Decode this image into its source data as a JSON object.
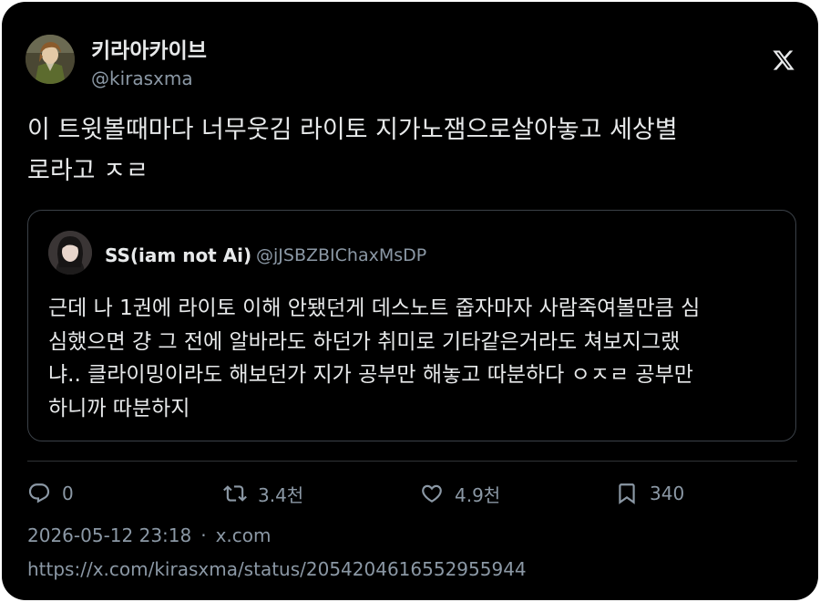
{
  "author": {
    "display_name": "키라아카이브",
    "handle": "@kirasxma"
  },
  "tweet": {
    "text_line1": "이 트윗볼때마다 너무웃김 라이토 지가노잼으로살아놓고 세상별",
    "text_line2": "로라고 ㅈㄹ"
  },
  "quote": {
    "display_name": "SS(iam not Ai)",
    "handle": "@jJSBZBIChaxMsDP",
    "text_line1": "근데 나 1권에 라이토 이해 안됐던게 데스노트 줍자마자 사람죽여볼만큼 심",
    "text_line2": "심했으면 걍 그 전에 알바라도 하던가 취미로 기타같은거라도 쳐보지그랬",
    "text_line3": "냐.. 클라이밍이라도 해보던가 지가 공부만 해놓고 따분하다 ㅇㅈㄹ 공부만",
    "text_line4": "하니까 따분하지"
  },
  "actions": {
    "replies": "0",
    "reposts": "3.4천",
    "likes": "4.9천",
    "bookmarks": "340"
  },
  "meta": {
    "timestamp": "2026-05-12 23:18",
    "separator": "·",
    "source": "x.com",
    "url": "https://x.com/kirasxma/status/2054204616552955944"
  },
  "icons": {
    "logo": "x-logo-icon",
    "reply": "reply-icon",
    "repost": "repost-icon",
    "like": "heart-icon",
    "bookmark": "bookmark-icon"
  },
  "colors": {
    "background": "#000000",
    "text": "#e7e9ea",
    "secondary_text": "#8b98a5",
    "border": "#3b4148"
  }
}
